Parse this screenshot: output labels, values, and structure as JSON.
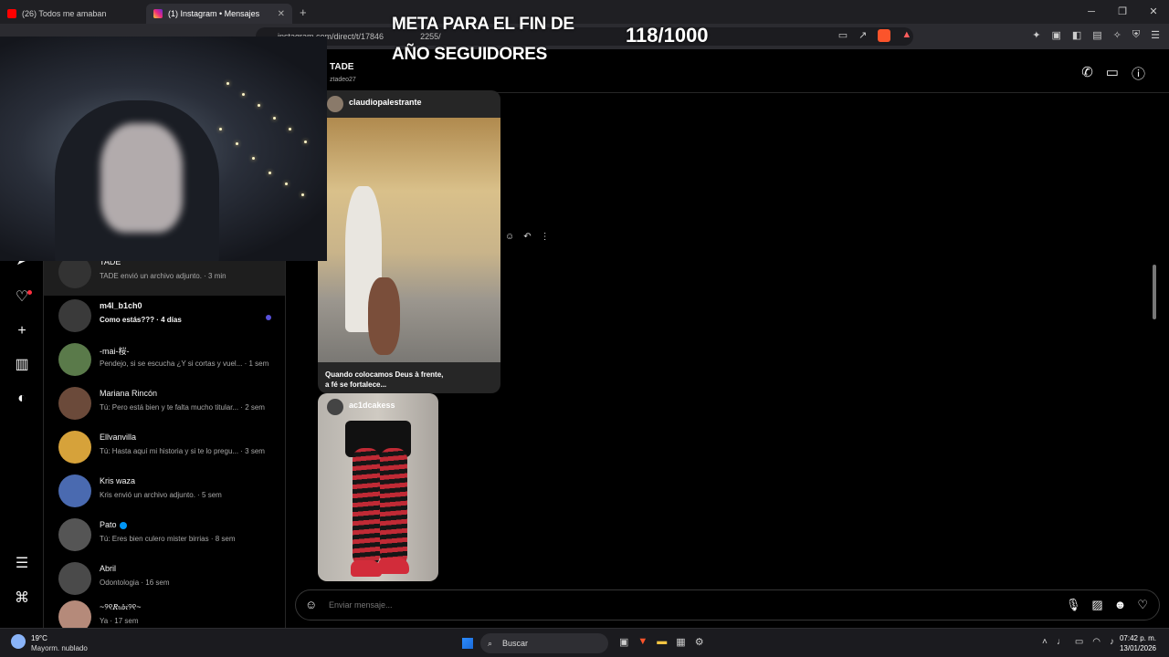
{
  "browser": {
    "tabs": [
      {
        "label": "(26) Todos me amaban",
        "active": false
      },
      {
        "label": "(1) Instagram • Mensajes",
        "active": true
      }
    ],
    "url": "instagram.com/direct/t/17846",
    "url_tail": "2255/"
  },
  "overlay": {
    "goal_line1": "META PARA EL FIN DE",
    "goal_line2": "AÑO SEGUIDORES",
    "goal_count": "118/1000"
  },
  "chat": {
    "name": "TADE",
    "username": "ztadeo27",
    "posts": [
      {
        "user": "claudiopalestrante",
        "caption_line1": "Quando colocamos Deus à frente,",
        "caption_line2": "a fé se fortalece..."
      },
      {
        "user": "ac1dcakess"
      }
    ],
    "composer_placeholder": "Enviar mensaje..."
  },
  "conversations": [
    {
      "name": "TADE",
      "sub": "TADE envió un archivo adjunto. · 3 min",
      "active": true,
      "unread": false
    },
    {
      "name": "m4l_b1ch0",
      "sub": "Como estás??? · 4 días",
      "active": false,
      "unread": true
    },
    {
      "name": "-mai-桜-",
      "sub": "Pendejo, si se escucha ¿Y si cortas y vuel... · 1 sem",
      "active": false,
      "unread": false
    },
    {
      "name": "Mariana Rincón",
      "sub": "Tú: Pero está bien y te falta mucho titular... · 2 sem",
      "active": false,
      "unread": false
    },
    {
      "name": "Ellvanvilla",
      "sub": "Tú: Hasta aquí mi historia y si te lo pregu... · 3 sem",
      "active": false,
      "unread": false
    },
    {
      "name": "Kris waza",
      "sub": "Kris envió un archivo adjunto. · 5 sem",
      "active": false,
      "unread": false
    },
    {
      "name": "Pato",
      "sub": "Tú: Eres bien culero mister birrias · 8 sem",
      "active": false,
      "unread": false
    },
    {
      "name": "Abril",
      "sub": "Odontologia · 16 sem",
      "active": false,
      "unread": false
    },
    {
      "name": "~୨୧𝑅𝑢𝑏𝑖୨୧~",
      "sub": "Ya · 17 sem",
      "active": false,
      "unread": false
    }
  ],
  "taskbar": {
    "temperature": "19°C",
    "weather": "Mayorm. nublado",
    "search_label": "Buscar",
    "time": "07:42 p. m.",
    "date": "13/01/2026"
  }
}
